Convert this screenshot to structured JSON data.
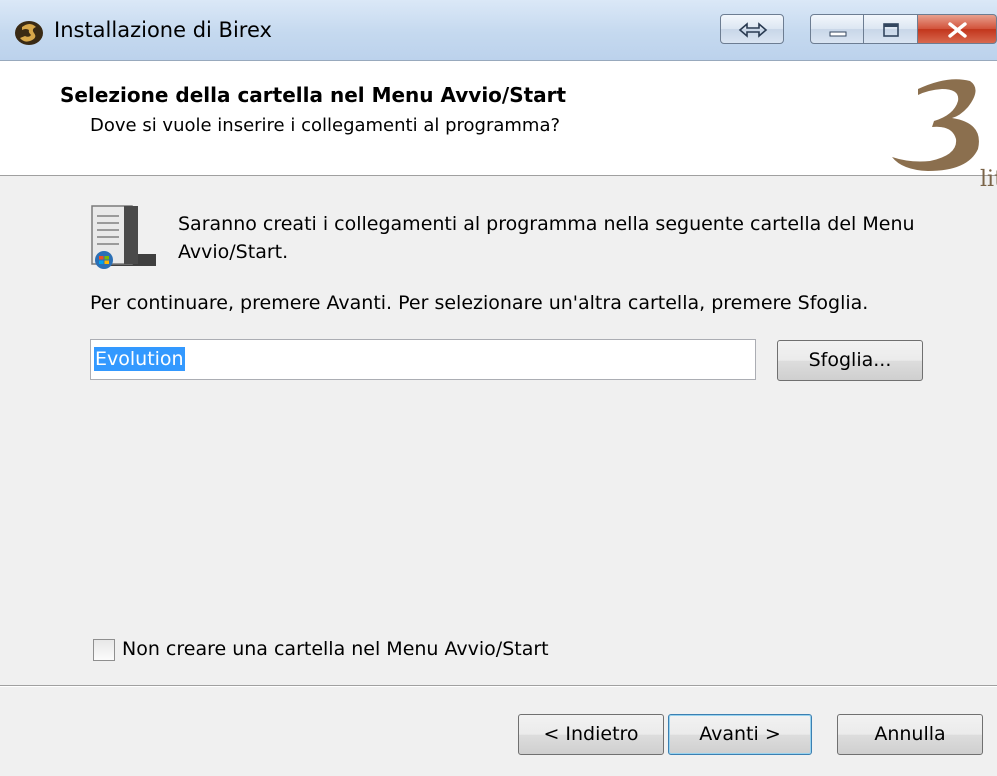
{
  "window": {
    "title": "Installazione di Birex"
  },
  "header": {
    "title": "Selezione della cartella nel Menu Avvio/Start",
    "subtitle": "Dove si vuole inserire i collegamenti al programma?",
    "logo_text": "lit"
  },
  "content": {
    "description": "Saranno creati i collegamenti al programma nella seguente cartella del Menu Avvio/Start.",
    "instructions": "Per continuare, premere Avanti. Per selezionare un'altra cartella, premere Sfoglia.",
    "folder_value": "Evolution",
    "browse_label": "Sfoglia...",
    "checkbox_label": "Non creare una cartella nel Menu Avvio/Start",
    "checkbox_checked": false
  },
  "footer": {
    "back_label": "< Indietro",
    "next_label": "Avanti >",
    "cancel_label": "Annulla"
  },
  "colors": {
    "selection": "#3399ff",
    "logo": "#8b6f4e",
    "titlebar": "#c5d9ef",
    "close_button": "#c2351c"
  },
  "icons": [
    "birex-app-icon",
    "switch-arrows-icon",
    "minimize-icon",
    "maximize-icon",
    "close-icon",
    "start-menu-folder-icon",
    "brand-logo"
  ]
}
